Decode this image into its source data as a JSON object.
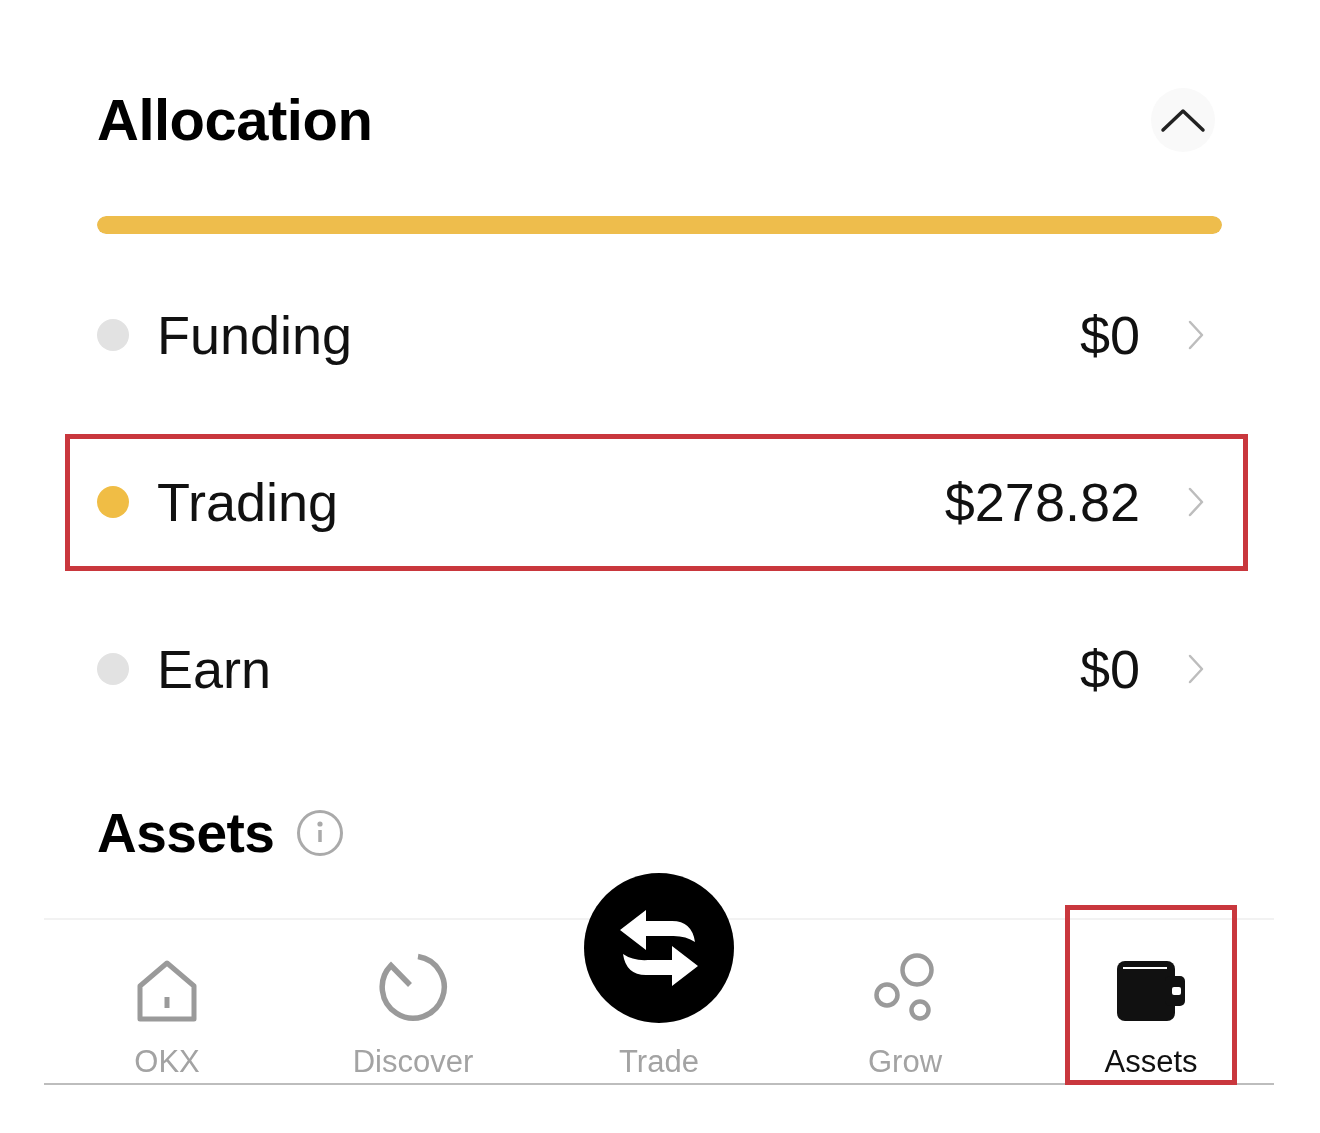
{
  "allocation": {
    "title": "Allocation",
    "expanded": true,
    "bar": {
      "level": 1
    }
  },
  "accounts": [
    {
      "name": "Funding",
      "amount": "$0",
      "color": "#e2e2e2",
      "highlighted": false
    },
    {
      "name": "Trading",
      "amount": "$278.82",
      "color": "#f0bd45",
      "highlighted": true
    },
    {
      "name": "Earn",
      "amount": "$0",
      "color": "#e2e2e2",
      "highlighted": false
    }
  ],
  "assets": {
    "title": "Assets"
  },
  "tab_bar": [
    {
      "label": "OKX",
      "kind": "home",
      "selected": false,
      "highlighted": false
    },
    {
      "label": "Discover",
      "kind": "discover",
      "selected": false,
      "highlighted": false
    },
    {
      "label": "Trade",
      "kind": "trade",
      "selected": false,
      "highlighted": false
    },
    {
      "label": "Grow",
      "kind": "grow",
      "selected": false,
      "highlighted": false
    },
    {
      "label": "Assets",
      "kind": "wallet",
      "selected": true,
      "highlighted": true
    }
  ]
}
